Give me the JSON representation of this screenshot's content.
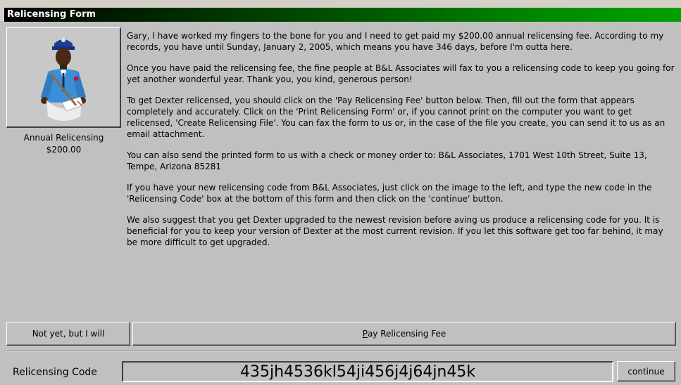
{
  "window": {
    "title": "Relicensing Form"
  },
  "product": {
    "caption_line1": "Annual Relicensing",
    "caption_line2": "$200.00"
  },
  "message": {
    "p1": "Gary, I have worked my fingers to the bone for you and I need to get paid my $200.00 annual relicensing fee. According to my records, you have until Sunday, January 2, 2005, which means you have 346 days, before I'm outta here.",
    "p2": "Once you have paid the relicensing fee, the fine people at B&L Associates will fax to you a relicensing code to keep you going for yet another wonderful year. Thank you, you kind, generous person!",
    "p3": "To get Dexter relicensed, you should click on the 'Pay Relicensing Fee' button below. Then, fill out the form that appears completely and accurately. Click on the 'Print Relicensing Form' or, if you cannot print on the computer you want to get relicensed, 'Create Relicensing File'. You can fax the form to us or, in the case of the file you create, you can send it to us as an email attachment.",
    "p4": "You can also send the printed form to us with a check or money order to: B&L Associates, 1701 West 10th Street, Suite 13, Tempe, Arizona 85281",
    "p5": "If you have your new relicensing code from B&L Associates, just click on the image to the left, and type the new code in the 'Relicensing Code' box at the bottom of this form and then click on the 'continue' button.",
    "p6": "We also suggest that you get Dexter upgraded to the newest revision before aving us produce a relicensing code for you. It is beneficial for you to keep your version of Dexter at the most current revision. If you let this software get too far behind, it may be more difficult to get upgraded."
  },
  "buttons": {
    "not_yet": "Not yet, but I will",
    "pay_rest": "ay Relicensing Fee",
    "pay_accel": "P",
    "continue": "continue"
  },
  "code": {
    "label": "Relicensing Code",
    "value": "435jh4536kl54ji456j4j64jn45k"
  },
  "icons": {
    "mailman": "mailman-icon"
  }
}
